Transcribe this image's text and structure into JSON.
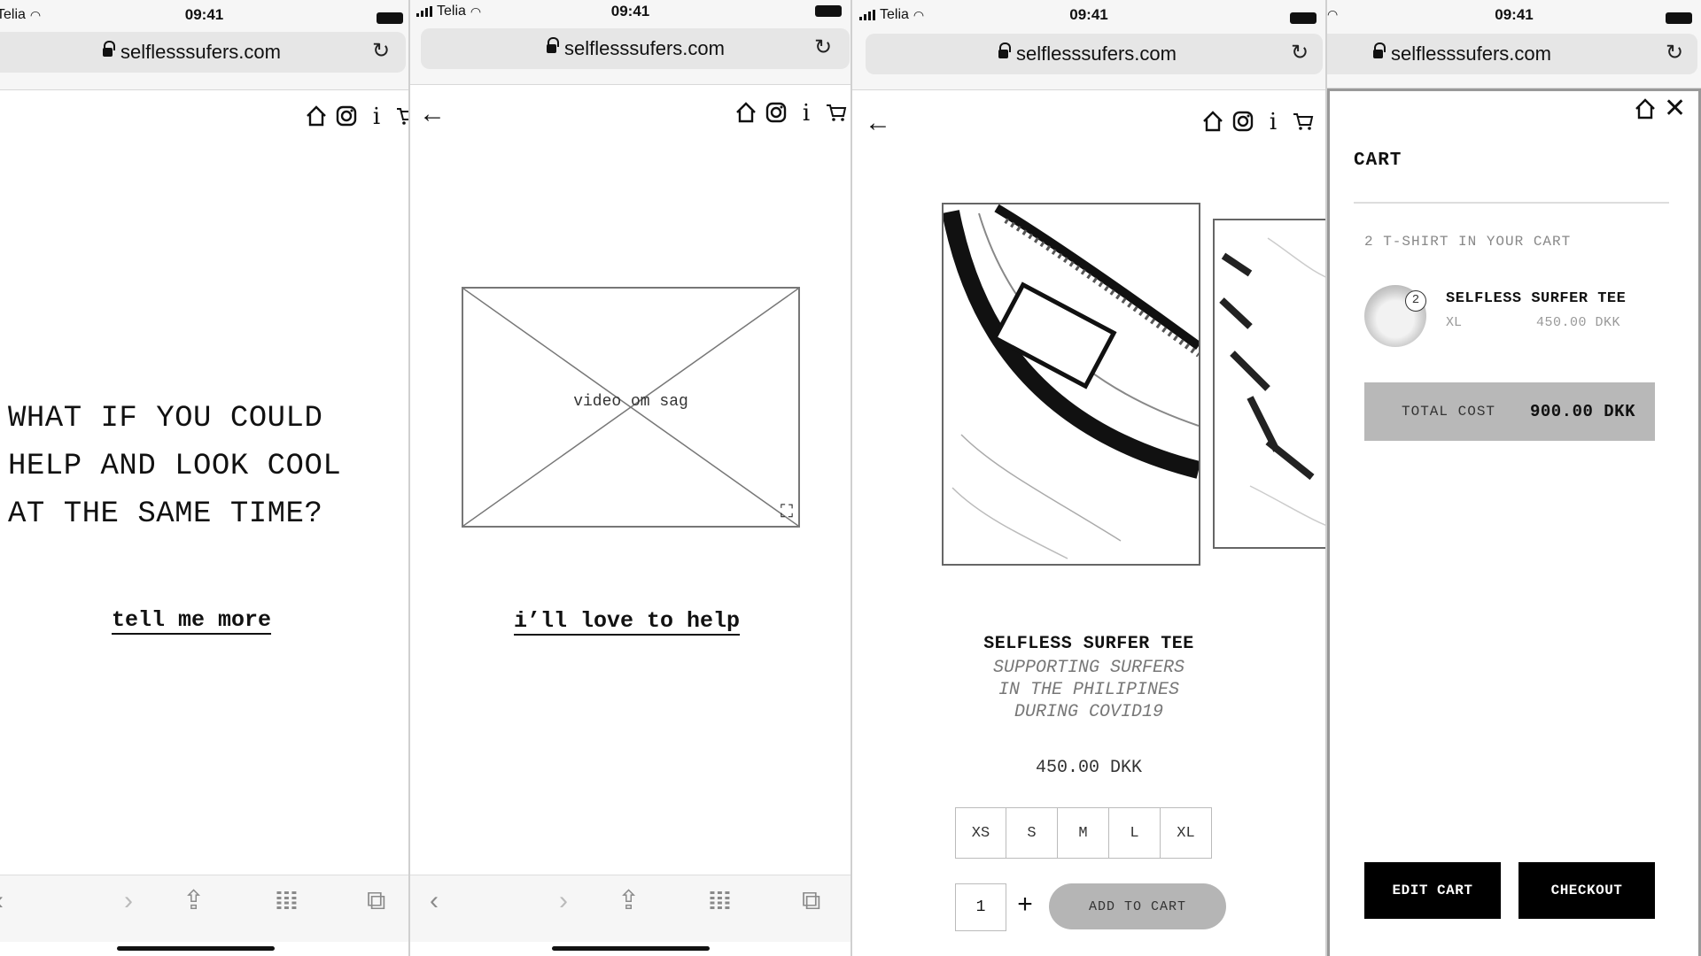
{
  "url": "selflesssufers.com",
  "status": {
    "carrier": "Telia",
    "time": "09:41"
  },
  "icons": [
    "home-icon",
    "instagram-icon",
    "info-icon",
    "cart-icon",
    "back-arrow-icon",
    "reload-icon",
    "lock-icon",
    "close-icon",
    "expand-icon",
    "share-icon",
    "bookmarks-icon",
    "tabs-icon"
  ],
  "landing": {
    "headline": [
      "WHAT IF YOU COULD",
      "HELP AND LOOK COOL",
      "AT THE SAME TIME?"
    ],
    "cta": "tell me more"
  },
  "video_page": {
    "placeholder": "video om sag",
    "cta": "i’ll love to help"
  },
  "product": {
    "title": "SELFLESS SURFER TEE",
    "subtitle": [
      "SUPPORTING SURFERS",
      "IN THE PHILIPINES",
      "DURING COVID19"
    ],
    "price": "450.00 DKK",
    "sizes": [
      "XS",
      "S",
      "M",
      "L",
      "XL"
    ],
    "quantity": "1",
    "plus": "+",
    "add_to_cart": "ADD TO CART"
  },
  "cart": {
    "title": "CART",
    "count_text": "2 T-SHIRT IN YOUR CART",
    "badge": "2",
    "item": {
      "name": "SELFLESS SURFER TEE",
      "size": "XL",
      "price": "450.00 DKK"
    },
    "total_label": "TOTAL COST",
    "total_value": "900.00 DKK",
    "edit": "EDIT CART",
    "checkout": "CHECKOUT"
  }
}
